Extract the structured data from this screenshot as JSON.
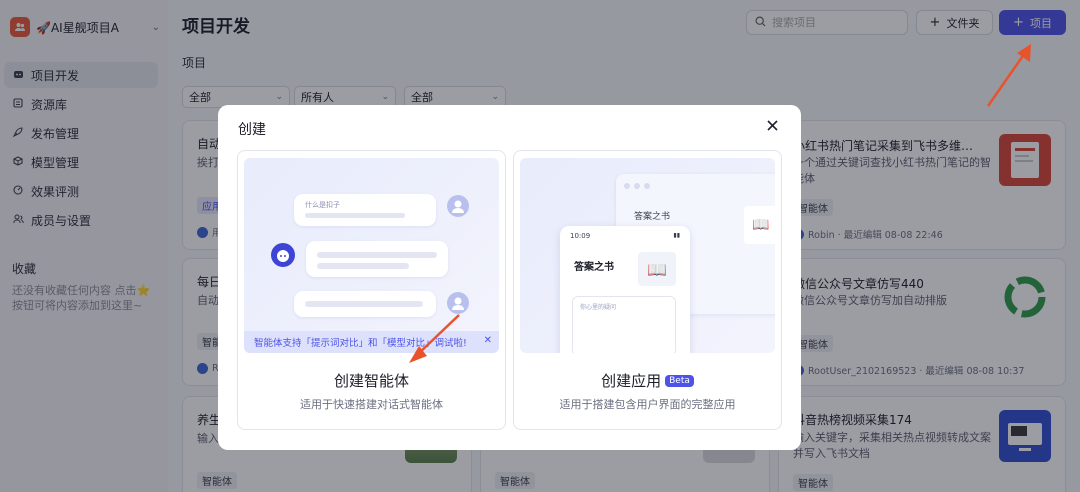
{
  "workspace": {
    "name": "🚀AI星舰项目A",
    "avatar_icon": "team-icon"
  },
  "nav": [
    {
      "label": "项目开发",
      "icon": "robot-icon",
      "active": true
    },
    {
      "label": "资源库",
      "icon": "library-icon",
      "active": false
    },
    {
      "label": "发布管理",
      "icon": "rocket-icon",
      "active": false
    },
    {
      "label": "模型管理",
      "icon": "cube-icon",
      "active": false
    },
    {
      "label": "效果评测",
      "icon": "gauge-icon",
      "active": false
    },
    {
      "label": "成员与设置",
      "icon": "members-icon",
      "active": false
    }
  ],
  "favorites": {
    "title": "收藏",
    "hint": "还没有收藏任何内容 点击⭐按钮可将内容添加到这里~"
  },
  "header": {
    "title": "项目开发",
    "search_placeholder": "搜索项目",
    "folder_label": "文件夹",
    "project_label": "项目"
  },
  "section_label": "项目",
  "filters": [
    "全部",
    "所有人",
    "全部"
  ],
  "cards": [
    {
      "title": "自动",
      "desc": "挨打",
      "tag": "应用",
      "meta": "用"
    },
    {
      "title": "每日",
      "desc": "自动",
      "tag": "智能体",
      "meta": "R"
    },
    {
      "title": "养生",
      "desc": "输入",
      "tag": "智能体",
      "meta": ""
    },
    {
      "title": "",
      "desc": "",
      "tag": "智能体",
      "meta": ""
    },
    {
      "title": "小红书热门笔记采集到飞书多维…",
      "desc": "一个通过关键词查找小红书热门笔记的智能体",
      "tag": "智能体",
      "meta": "Robin · 最近编辑 08-08 22:46"
    },
    {
      "title": "微信公众号文章仿写440",
      "desc": "微信公众号文章仿写加自动排版",
      "tag": "智能体",
      "meta": "RootUser_2102169523 · 最近编辑 08-08 10:37"
    },
    {
      "title": "抖音热榜视频采集174",
      "desc": "输入关键字，采集相关热点视频转成文案并写入飞书文档",
      "tag": "智能体",
      "meta": ""
    }
  ],
  "modal": {
    "title": "创建",
    "agent": {
      "title": "创建智能体",
      "subtitle": "适用于快速搭建对话式智能体",
      "illus_question": "什么是扣子",
      "banner": "智能体支持「提示词对比」和「模型对比」调试啦!"
    },
    "app": {
      "title": "创建应用",
      "badge": "Beta",
      "subtitle": "适用于搭建包含用户界面的完整应用",
      "illus_name": "答案之书",
      "illus_time": "10:09",
      "illus_prompt": "你心里的疑问"
    }
  },
  "colors": {
    "accent": "#4d53e8",
    "annotation_arrow": "#e8532c"
  }
}
